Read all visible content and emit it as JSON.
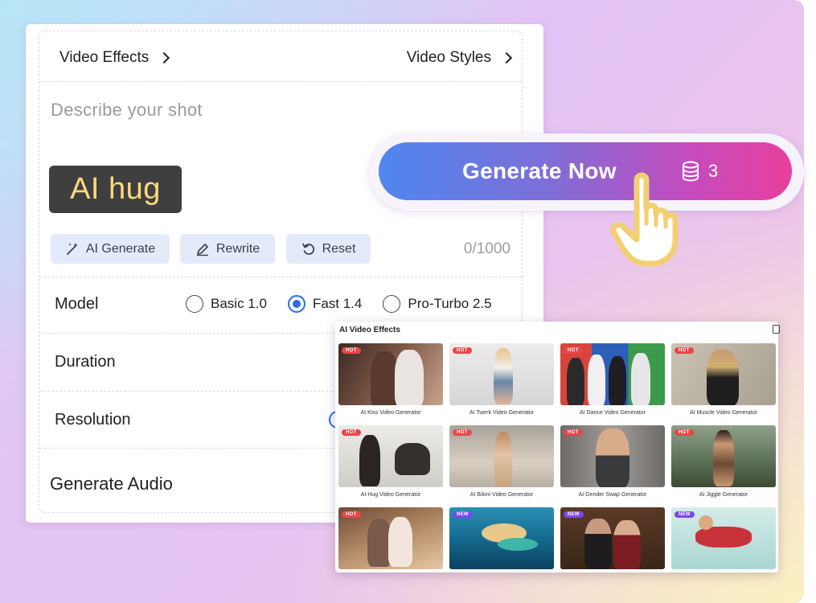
{
  "editor": {
    "video_effects": "Video Effects",
    "video_styles": "Video Styles",
    "prompt_placeholder": "Describe your shot",
    "prompt_tag": "AI hug",
    "ai_generate": "AI Generate",
    "rewrite": "Rewrite",
    "reset": "Reset",
    "char_count": "0/1000",
    "model_label": "Model",
    "models": [
      "Basic 1.0",
      "Fast 1.4",
      "Pro-Turbo 2.5"
    ],
    "selected_model": "Fast 1.4",
    "duration_label": "Duration",
    "resolution_label": "Resolution",
    "audio_label": "Generate Audio"
  },
  "generate": {
    "label": "Generate Now",
    "cost": "3"
  },
  "effects_panel": {
    "title": "AI Video Effects",
    "tiles": [
      {
        "label": "AI Kiss Video Generator",
        "badge": "HOT"
      },
      {
        "label": "AI Twerk Video Generator",
        "badge": "HOT"
      },
      {
        "label": "AI Dance Video Generator",
        "badge": "HOT"
      },
      {
        "label": "AI Muscle Video Generator",
        "badge": "HOT"
      },
      {
        "label": "AI Hug Video Generator",
        "badge": "HOT"
      },
      {
        "label": "AI Bikini Video Generator",
        "badge": "HOT"
      },
      {
        "label": "AI Gender Swap Generator",
        "badge": "HOT"
      },
      {
        "label": "AI Jiggle Generator",
        "badge": "HOT"
      },
      {
        "label": "",
        "badge": "HOT"
      },
      {
        "label": "",
        "badge": "NEW"
      },
      {
        "label": "",
        "badge": "NEW"
      },
      {
        "label": "",
        "badge": "NEW"
      }
    ]
  },
  "colors": {
    "accent_blue": "#2b6fe0",
    "button_start": "#4f86f0",
    "button_end": "#e83f9d",
    "tag_text": "#fcd97a",
    "hot_badge": "#e8474a",
    "new_badge": "#7a4ae6"
  }
}
